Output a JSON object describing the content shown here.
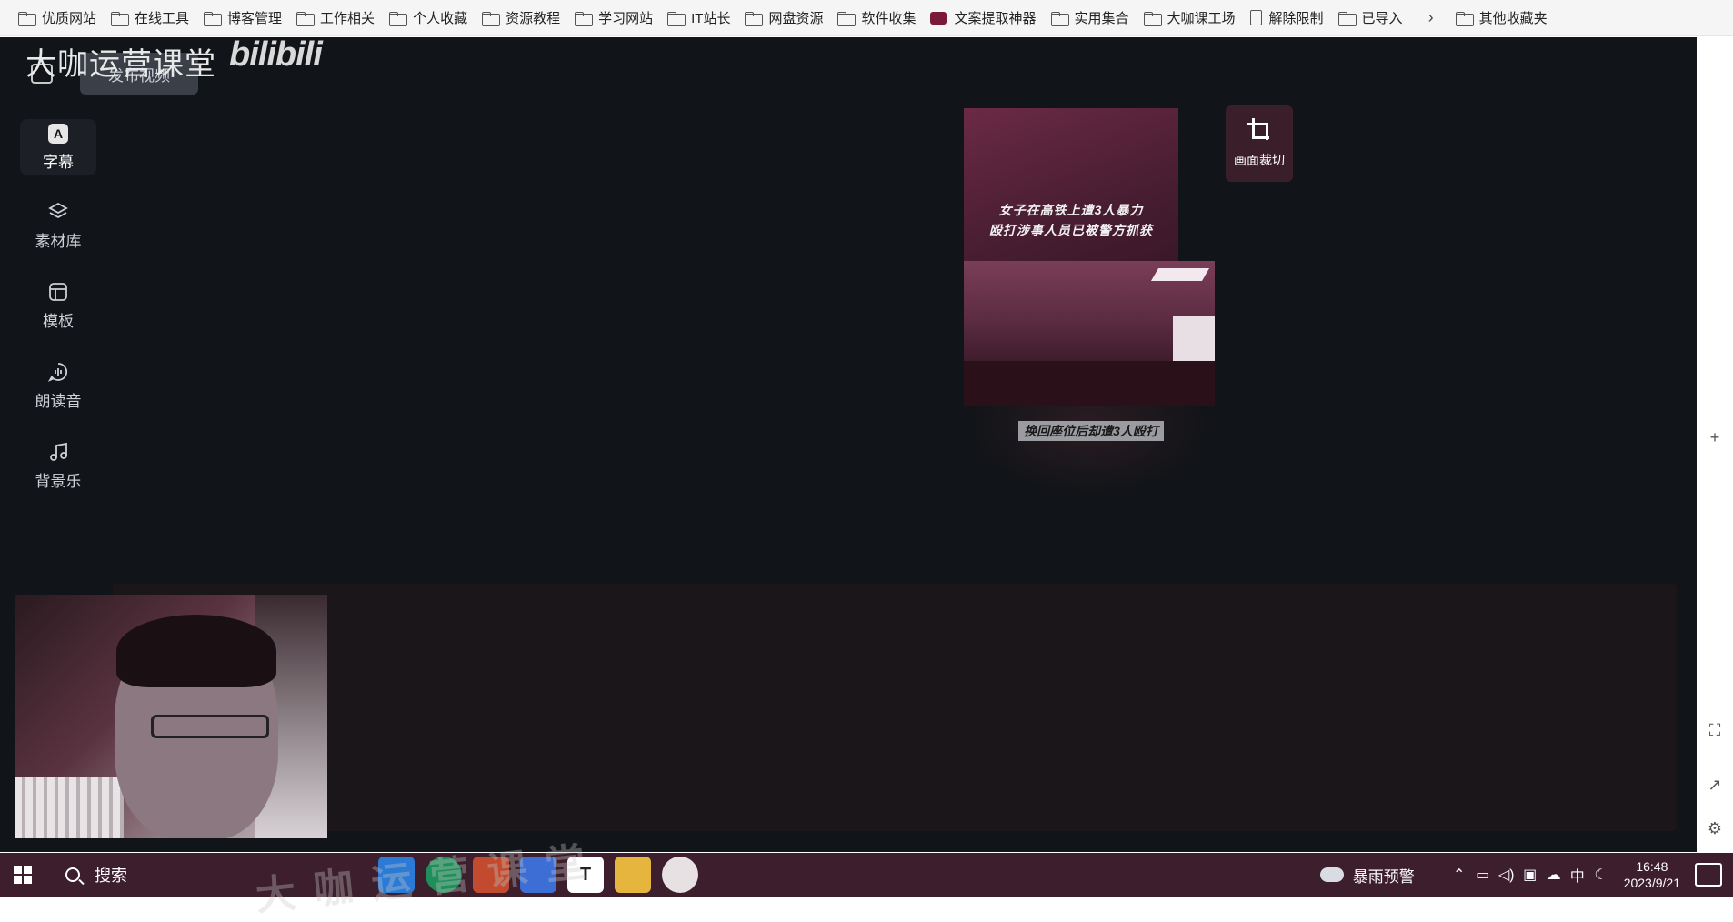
{
  "bookmarks": [
    {
      "label": "优质网站",
      "icon": "folder-icon"
    },
    {
      "label": "在线工具",
      "icon": "folder-icon"
    },
    {
      "label": "博客管理",
      "icon": "folder-icon"
    },
    {
      "label": "工作相关",
      "icon": "folder-icon"
    },
    {
      "label": "个人收藏",
      "icon": "folder-icon"
    },
    {
      "label": "资源教程",
      "icon": "folder-icon"
    },
    {
      "label": "学习网站",
      "icon": "folder-icon"
    },
    {
      "label": "IT站长",
      "icon": "folder-icon"
    },
    {
      "label": "网盘资源",
      "icon": "folder-icon"
    },
    {
      "label": "软件收集",
      "icon": "folder-icon"
    },
    {
      "label": "文案提取神器",
      "icon": "app-icon"
    },
    {
      "label": "实用集合",
      "icon": "folder-icon"
    },
    {
      "label": "大咖课工场",
      "icon": "folder-icon"
    },
    {
      "label": "解除限制",
      "icon": "document-icon"
    },
    {
      "label": "已导入",
      "icon": "folder-icon"
    }
  ],
  "bookmarks_more": "›",
  "bookmarks_other": "其他收藏夹",
  "header": {
    "brand_title": "大咖运营课堂",
    "logo_text": "bilibili",
    "publish_button": "发布视频"
  },
  "sidebar": {
    "items": [
      {
        "label": "字幕",
        "icon": "subtitle-icon",
        "active": true
      },
      {
        "label": "素材库",
        "icon": "layers-icon",
        "active": false
      },
      {
        "label": "模板",
        "icon": "template-icon",
        "active": false
      },
      {
        "label": "朗读音",
        "icon": "voice-icon",
        "active": false
      },
      {
        "label": "背景乐",
        "icon": "music-icon",
        "active": false
      }
    ]
  },
  "preview": {
    "headline_line1": "女子在高铁上遭3人暴力",
    "headline_line2": "殴打涉事人员已被警方抓获",
    "caption": "换回座位后却遭3人殴打"
  },
  "crop_button": {
    "label": "画面裁切",
    "icon": "crop-icon"
  },
  "taskbar": {
    "search_label": "搜索",
    "weather_label": "暴雨预警",
    "ime_label": "中",
    "time": "16:48",
    "date": "2023/9/21"
  },
  "watermark": "大咖运营课堂"
}
